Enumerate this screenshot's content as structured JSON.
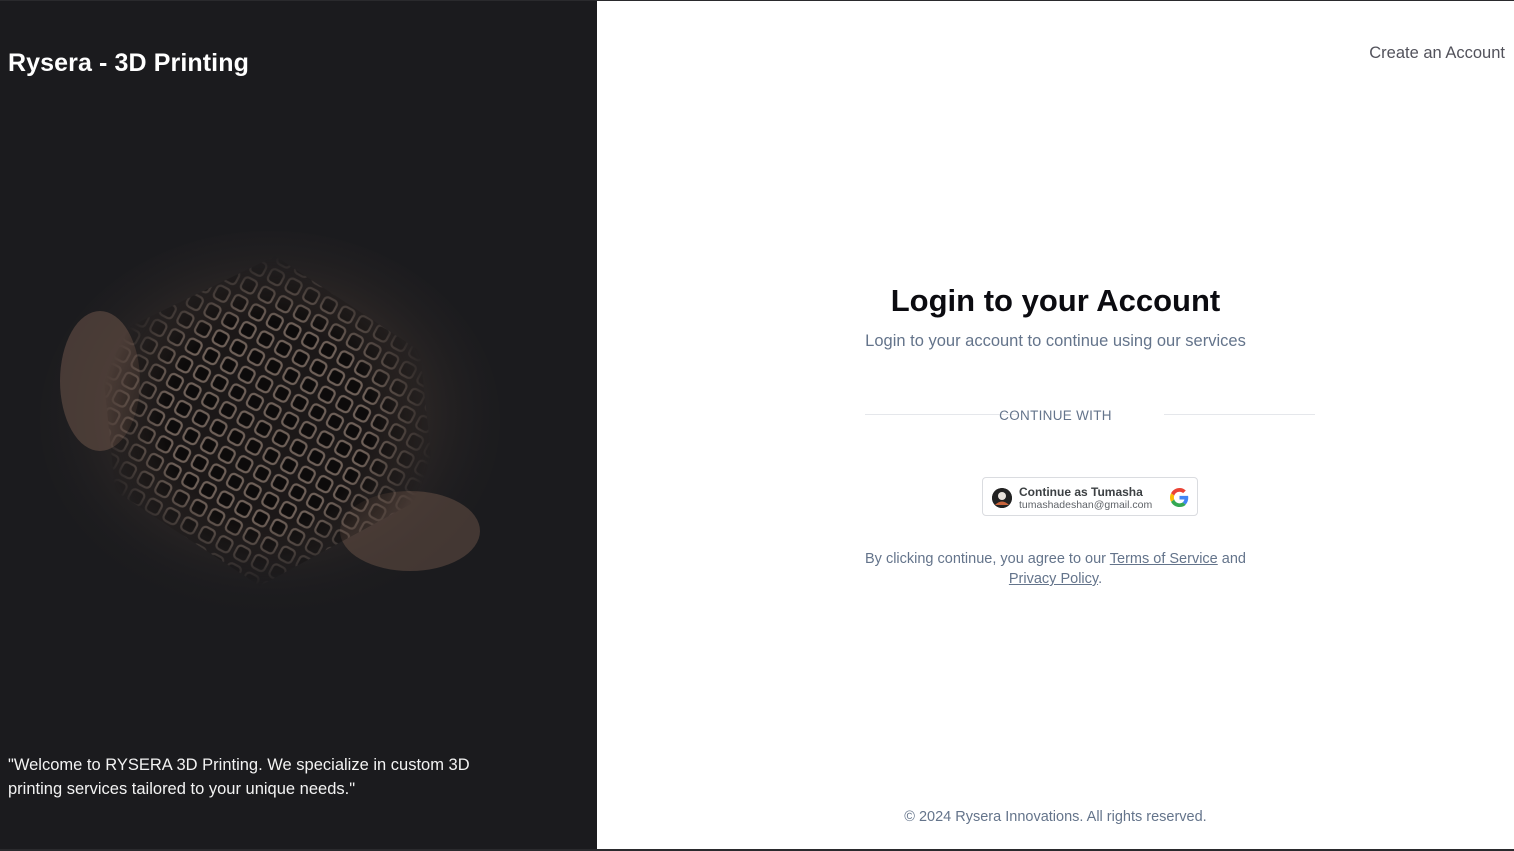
{
  "brand": {
    "title": "Rysera - 3D Printing"
  },
  "hero": {
    "quote": "\"Welcome to RYSERA 3D Printing. We specialize in custom 3D printing services tailored to your unique needs.\""
  },
  "header": {
    "create_account_label": "Create an Account"
  },
  "login": {
    "title": "Login to your Account",
    "subtitle": "Login to your account to continue using our services",
    "continue_with": "CONTINUE WITH"
  },
  "google_button": {
    "name_label": "Continue as Tumasha",
    "email": "tumashadeshan@gmail.com"
  },
  "agreement": {
    "prefix": "By clicking continue, you agree to our ",
    "terms_label": "Terms of Service",
    "middle": " and ",
    "privacy_label": "Privacy Policy",
    "suffix": "."
  },
  "footer": {
    "copyright": "© 2024 Rysera Innovations. All rights reserved."
  },
  "colors": {
    "left_background": "#1b1b1e",
    "right_background": "#ffffff",
    "title_text": "#0b0b10",
    "muted_text": "#64748b"
  }
}
